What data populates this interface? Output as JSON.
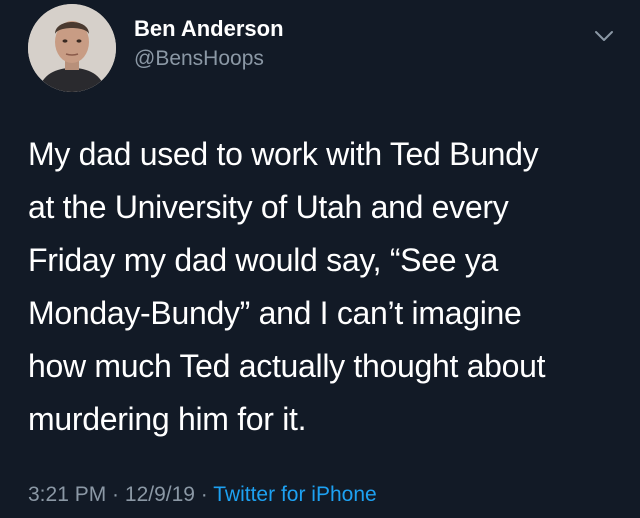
{
  "author": {
    "name": "Ben Anderson",
    "handle": "@BensHoops",
    "avatar_icon": "profile-photo"
  },
  "menu_icon": "chevron-down-icon",
  "tweet": {
    "lines": [
      "My dad used to work with Ted Bundy",
      "at the University of Utah and every",
      "Friday my dad would say, “See ya",
      "Monday-Bundy” and I can’t imagine",
      "how much Ted actually thought about",
      "murdering him for it."
    ]
  },
  "meta": {
    "time": "3:21 PM",
    "separator": " · ",
    "date": "12/9/19",
    "source": "Twitter for iPhone"
  },
  "colors": {
    "background": "#121a26",
    "text": "#ffffff",
    "muted": "#8b98a5",
    "link": "#1da1f2"
  }
}
